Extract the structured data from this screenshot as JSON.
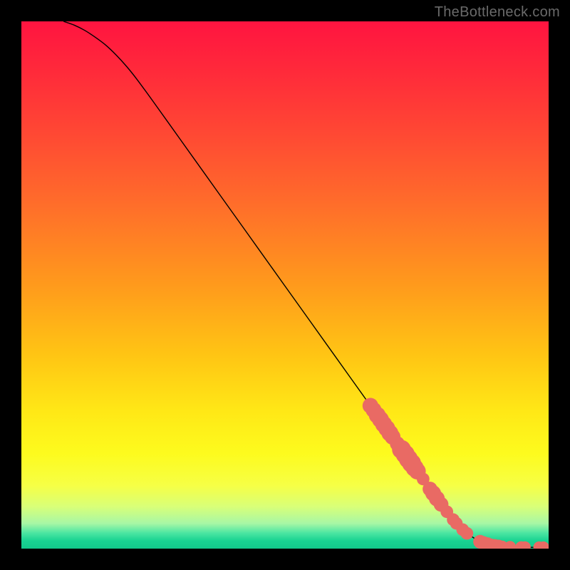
{
  "watermark": "TheBottleneck.com",
  "colors": {
    "curve": "#000000",
    "points": "#e96a64",
    "points_stroke": "#e96a64",
    "gradient_stops": [
      {
        "offset": 0.0,
        "color": "#ff1440"
      },
      {
        "offset": 0.1,
        "color": "#ff2b3a"
      },
      {
        "offset": 0.22,
        "color": "#ff4a33"
      },
      {
        "offset": 0.35,
        "color": "#ff6e2a"
      },
      {
        "offset": 0.5,
        "color": "#ff9a1c"
      },
      {
        "offset": 0.63,
        "color": "#ffc414"
      },
      {
        "offset": 0.74,
        "color": "#ffe816"
      },
      {
        "offset": 0.82,
        "color": "#fdfb1e"
      },
      {
        "offset": 0.88,
        "color": "#f6ff45"
      },
      {
        "offset": 0.92,
        "color": "#d9ff78"
      },
      {
        "offset": 0.952,
        "color": "#a8f7a5"
      },
      {
        "offset": 0.97,
        "color": "#4de6a2"
      },
      {
        "offset": 0.985,
        "color": "#19d392"
      },
      {
        "offset": 1.0,
        "color": "#12c98b"
      }
    ]
  },
  "chart_data": {
    "type": "line",
    "title": "",
    "xlabel": "",
    "ylabel": "",
    "xlim": [
      0,
      100
    ],
    "ylim": [
      0,
      100
    ],
    "series": [
      {
        "name": "curve",
        "x": [
          8,
          10,
          12,
          14,
          16,
          18,
          20,
          22,
          25,
          30,
          35,
          40,
          45,
          50,
          55,
          60,
          65,
          70,
          73,
          76,
          80,
          82,
          84,
          86.5,
          89,
          92,
          96,
          100
        ],
        "y": [
          100,
          99.3,
          98.3,
          97,
          95.5,
          93.6,
          91.4,
          88.9,
          84.8,
          77.8,
          70.8,
          63.8,
          56.8,
          49.8,
          42.8,
          35.8,
          28.8,
          21.8,
          17.6,
          13.4,
          7.9,
          5.4,
          3.4,
          1.6,
          0.7,
          0.35,
          0.25,
          0.25
        ]
      }
    ],
    "points_on_curve": [
      {
        "x": 66.2,
        "y": 27.1,
        "r": 1.5
      },
      {
        "x": 66.8,
        "y": 26.3,
        "r": 1.5
      },
      {
        "x": 67.5,
        "y": 25.3,
        "r": 1.6
      },
      {
        "x": 68.1,
        "y": 24.5,
        "r": 1.6
      },
      {
        "x": 68.7,
        "y": 23.6,
        "r": 1.6
      },
      {
        "x": 69.3,
        "y": 22.8,
        "r": 1.6
      },
      {
        "x": 69.9,
        "y": 21.9,
        "r": 1.6
      },
      {
        "x": 70.4,
        "y": 21.2,
        "r": 1.5
      },
      {
        "x": 71.3,
        "y": 19.9,
        "r": 1.4
      },
      {
        "x": 72.1,
        "y": 18.8,
        "r": 1.8
      },
      {
        "x": 72.8,
        "y": 17.9,
        "r": 1.8
      },
      {
        "x": 73.4,
        "y": 17.0,
        "r": 1.8
      },
      {
        "x": 74.0,
        "y": 16.2,
        "r": 1.8
      },
      {
        "x": 74.6,
        "y": 15.3,
        "r": 1.7
      },
      {
        "x": 75.1,
        "y": 14.7,
        "r": 1.6
      },
      {
        "x": 76.2,
        "y": 13.2,
        "r": 1.2
      },
      {
        "x": 77.5,
        "y": 11.3,
        "r": 1.4
      },
      {
        "x": 78.1,
        "y": 10.5,
        "r": 1.5
      },
      {
        "x": 78.8,
        "y": 9.5,
        "r": 1.5
      },
      {
        "x": 79.6,
        "y": 8.4,
        "r": 1.4
      },
      {
        "x": 80.7,
        "y": 7.0,
        "r": 1.2
      },
      {
        "x": 81.9,
        "y": 5.5,
        "r": 1.2
      },
      {
        "x": 82.5,
        "y": 4.8,
        "r": 1.2
      },
      {
        "x": 83.7,
        "y": 3.6,
        "r": 1.2
      },
      {
        "x": 84.5,
        "y": 2.9,
        "r": 1.2
      },
      {
        "x": 87.0,
        "y": 1.3,
        "r": 1.3
      },
      {
        "x": 87.7,
        "y": 1.05,
        "r": 1.3
      },
      {
        "x": 88.4,
        "y": 0.85,
        "r": 1.3
      },
      {
        "x": 89.1,
        "y": 0.7,
        "r": 1.2
      },
      {
        "x": 89.8,
        "y": 0.6,
        "r": 1.2
      },
      {
        "x": 90.5,
        "y": 0.5,
        "r": 1.2
      },
      {
        "x": 91.2,
        "y": 0.42,
        "r": 1.1
      },
      {
        "x": 92.7,
        "y": 0.35,
        "r": 1.1
      },
      {
        "x": 94.8,
        "y": 0.3,
        "r": 1.1
      },
      {
        "x": 95.5,
        "y": 0.28,
        "r": 1.1
      },
      {
        "x": 98.2,
        "y": 0.27,
        "r": 1.1
      },
      {
        "x": 99.0,
        "y": 0.27,
        "r": 1.1
      }
    ]
  }
}
